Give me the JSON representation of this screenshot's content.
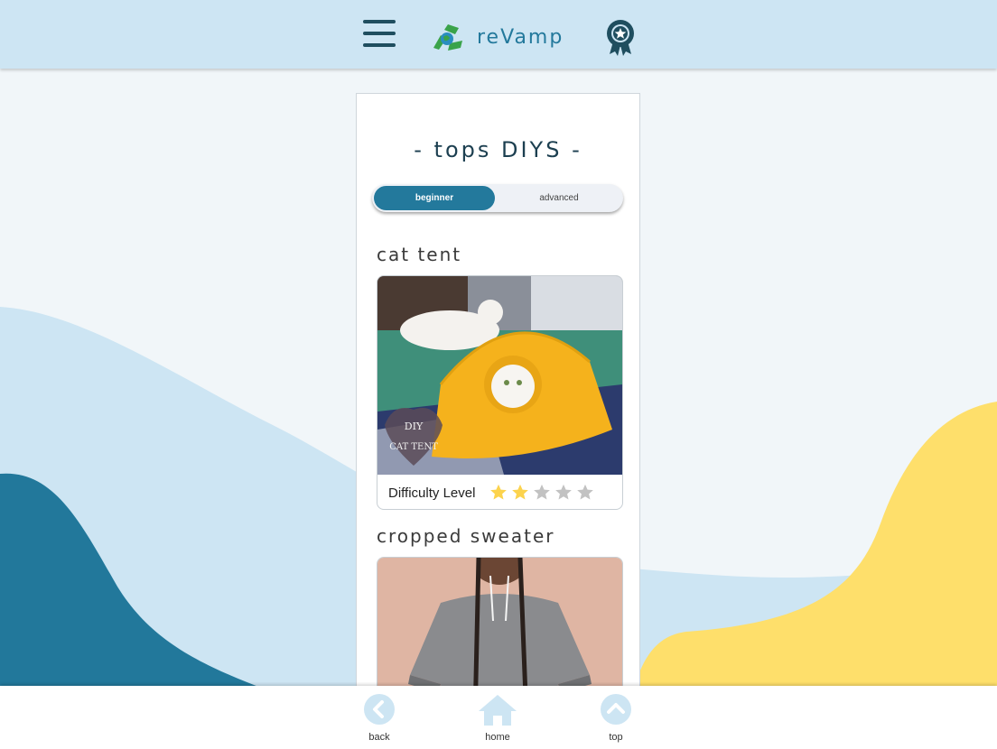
{
  "header": {
    "app_name": "reVamp",
    "menu_icon": "hamburger-menu-icon",
    "logo_icon": "recycle-globe-icon",
    "badge_icon": "award-badge-icon"
  },
  "page": {
    "title": "- tops DIYS -",
    "toggle": {
      "options": [
        "beginner",
        "advanced"
      ],
      "selected": "beginner"
    }
  },
  "items": [
    {
      "title": "cat tent",
      "image_caption_lines": [
        "DIY",
        "CAT TENT"
      ],
      "difficulty_label": "Difficulty Level",
      "difficulty_rating": 2,
      "difficulty_max": 5
    },
    {
      "title": "cropped sweater"
    }
  ],
  "bottom_nav": {
    "back": "back",
    "home": "home",
    "top": "top"
  },
  "colors": {
    "header_bg": "#cde5f3",
    "primary_teal": "#23799c",
    "dark_blue_wave": "#22789b",
    "light_blue_wave": "#cde5f3",
    "yellow_wave": "#fedf6b",
    "star_filled": "#fcd34d",
    "star_empty": "#c2c2c2"
  }
}
